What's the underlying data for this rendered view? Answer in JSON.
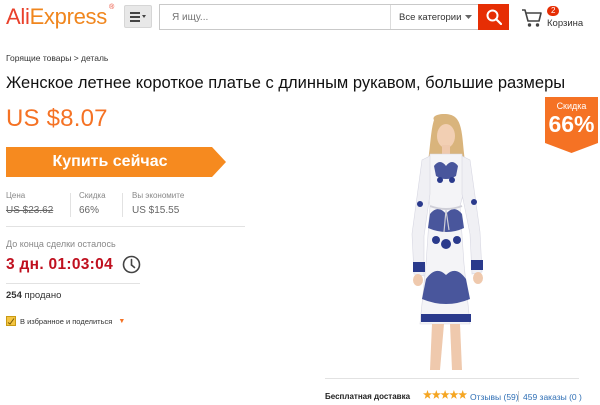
{
  "header": {
    "logo_part1": "Ali",
    "logo_part2": "Express",
    "logo_reg": "®",
    "menu_icon": "hamburger-icon",
    "search_placeholder": "Я ищу...",
    "search_category": "Все категории",
    "search_icon": "search-icon",
    "cart_count": "2",
    "cart_label": "Корзина",
    "cart_icon": "cart-icon"
  },
  "breadcrumb": "Горящие товары > деталь",
  "product": {
    "title": "Женское летнее короткое платье с длинным рукавом, большие размеры",
    "price": "US $8.07",
    "buy_label": "Купить сейчас",
    "price_label": "Цена",
    "old_price": "US $23.62",
    "discount_label": "Скидка",
    "discount_value": "66%",
    "save_label": "Вы экономите",
    "save_value": "US $15.55",
    "deal_label": "До конца сделки осталось",
    "timer": "3 дн. 01:03:04",
    "sold_count": "254",
    "sold_label": "продано",
    "fav_label": "В избранное и поделиться",
    "sale_badge_label": "Скидка",
    "sale_badge_value": "66%"
  },
  "footer": {
    "shipping": "Бесплатная доставка",
    "rating": 4.5,
    "reviews": "Отзывы (59)",
    "orders": "459 заказы (0 )"
  },
  "colors": {
    "brand_red": "#e62e04",
    "price_orange": "#f57224",
    "timer_red": "#c0101f",
    "link_blue": "#2f6fb5"
  }
}
